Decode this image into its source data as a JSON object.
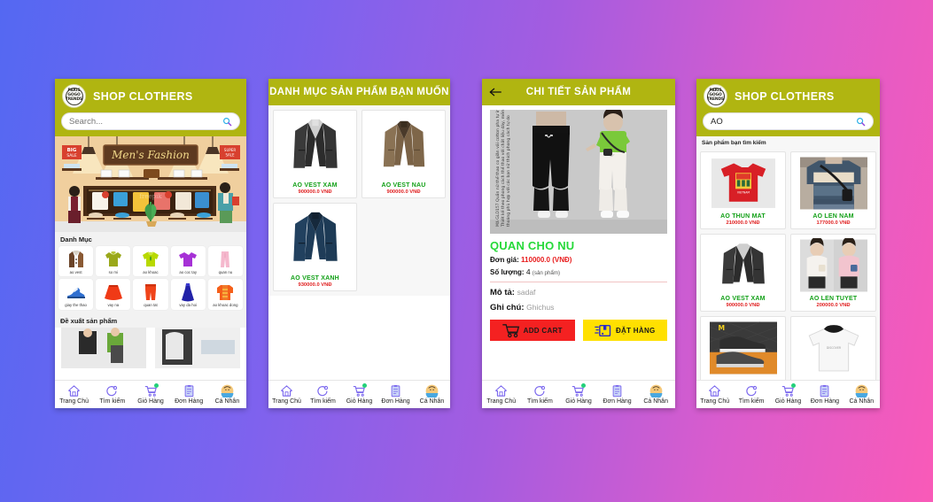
{
  "background": {
    "from": "#5468f2",
    "to": "#f95ab8"
  },
  "theme": {
    "header": "#b0b511",
    "price": "#e02020",
    "name_green": "#12a017",
    "nav": "#7b68ee"
  },
  "phone1": {
    "logo_text": "PARIS\nGOGO\nTRENDS",
    "title": "SHOP CLOTHERS",
    "search": {
      "value": "",
      "placeholder": "Search...",
      "icon": "search-icon"
    },
    "banner": {
      "sign": "Men's Fashion",
      "tag_left": "BIG SALE",
      "tag_right": "SUPER SALE"
    },
    "categories_heading": "Danh Mục",
    "categories": [
      {
        "label": "ao vest",
        "icon": "coat-icon",
        "color": "#7a4a2a"
      },
      {
        "label": "so mi",
        "icon": "shirt-icon",
        "color": "#9aa81a"
      },
      {
        "label": "ao khoac",
        "icon": "hoodie-icon",
        "color": "#b8d900"
      },
      {
        "label": "ao coc tay",
        "icon": "tshirt-icon",
        "color": "#a631d6"
      },
      {
        "label": "quan nu",
        "icon": "pants-icon",
        "color": "#f5b8cd"
      },
      {
        "label": "giay the thao",
        "icon": "sneaker-icon",
        "color": "#2f6fd0"
      },
      {
        "label": "vay na",
        "icon": "skirt-icon",
        "color": "#f03a16"
      },
      {
        "label": "quan tat",
        "icon": "trousers-icon",
        "color": "#f0441a"
      },
      {
        "label": "vay da hoi",
        "icon": "dress-icon",
        "color": "#2222a8"
      },
      {
        "label": "ao khoac dong",
        "icon": "winter-coat-icon",
        "color": "#f5601a"
      }
    ],
    "suggest_heading": "Đề xuất sản phẩm"
  },
  "phone2": {
    "title": "DANH MỤC SẢN PHẨM BẠN MUỐN",
    "products": [
      {
        "name": "AO VEST XAM",
        "price": "900000.0 VNĐ",
        "color": "#3a3a3a"
      },
      {
        "name": "AO VEST NAU",
        "price": "900000.0 VNĐ",
        "color": "#8a7254"
      },
      {
        "name": "AO VEST XANH",
        "price": "930000.0 VNĐ",
        "color": "#22415f"
      }
    ]
  },
  "phone3": {
    "title": "CHI TIẾT SẢN PHẨM",
    "back_icon": "back-arrow-icon",
    "product": {
      "name": "QUAN CHO NU",
      "price_label": "Đơn giá:",
      "price_value": "110000.0",
      "price_unit": "(VNĐ)",
      "qty_label": "Số lượng:",
      "qty_value": "4",
      "qty_unit": "(sản phẩm)",
      "desc_label": "Mô tả:",
      "desc_value": "sadaf",
      "note_label": "Ghi chú:",
      "note_value": "Ghichus",
      "image_caption": "Mã GLD157 Quần nữ thể thao co giãn vải cotton pha tự in Thiết kế theo phong cách thể thao với chất liệu dày, mềm, thoáng phù hợp với các bạn nữ thích phong cách tự do"
    },
    "buttons": {
      "add_cart": "ADD CART",
      "add_cart_icon": "cart-icon",
      "order": "ĐẶT HÀNG",
      "order_icon": "box-icon"
    }
  },
  "phone4": {
    "logo_text": "PARIS\nGOGO\nTRENDS",
    "title": "SHOP CLOTHERS",
    "search": {
      "value": "AO",
      "placeholder": "Search...",
      "icon": "search-icon"
    },
    "results_label": "Sản phẩm bạn tìm kiếm",
    "products": [
      {
        "name": "AO THUN MAT",
        "price": "210000.0 VNĐ",
        "color": "#d81f26"
      },
      {
        "name": "AO LEN NAM",
        "price": "177000.0 VNĐ",
        "color": "#41566b"
      },
      {
        "name": "AO VEST XAM",
        "price": "900000.0 VNĐ",
        "color": "#3a3a3a"
      },
      {
        "name": "AO LEN TUYET",
        "price": "200000.0 VNĐ",
        "color": "#f0d3d8"
      },
      {
        "name": "",
        "price": "",
        "color": "#2a2a2a"
      },
      {
        "name": "",
        "price": "",
        "color": "#ffffff"
      }
    ]
  },
  "bottom_nav": [
    {
      "label": "Trang Chủ",
      "icon": "home-icon",
      "badge": false
    },
    {
      "label": "Tìm kiếm",
      "icon": "search-icon",
      "badge": false
    },
    {
      "label": "Giỏ Hàng",
      "icon": "cart-icon",
      "badge": true
    },
    {
      "label": "Đơn Hàng",
      "icon": "clipboard-icon",
      "badge": false
    },
    {
      "label": "Cá Nhân",
      "icon": "avatar-icon",
      "badge": false
    }
  ]
}
